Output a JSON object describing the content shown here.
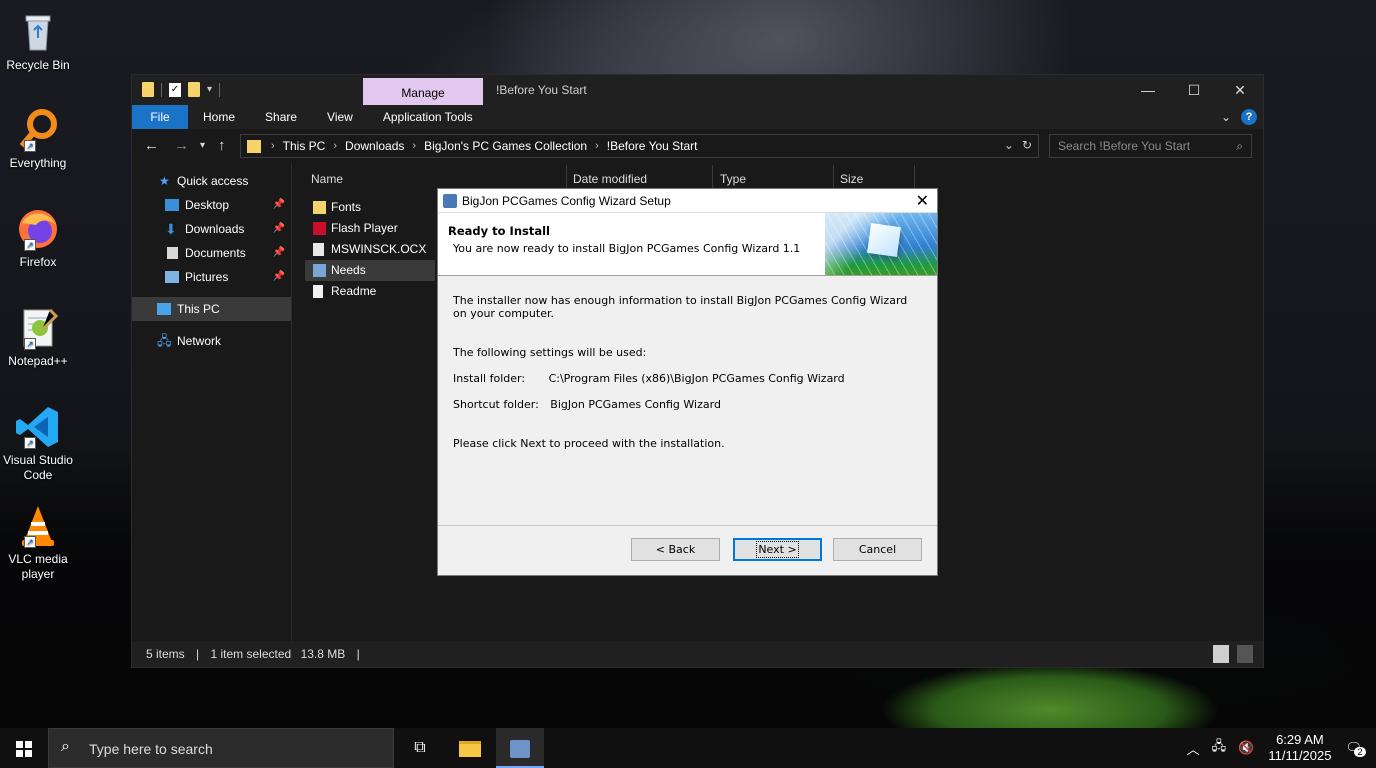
{
  "desktop": {
    "icons": [
      {
        "label": "Recycle Bin",
        "icon": "recycle-bin-icon"
      },
      {
        "label": "Everything",
        "icon": "everything-search-icon"
      },
      {
        "label": "Firefox",
        "icon": "firefox-icon"
      },
      {
        "label": "Notepad++",
        "icon": "notepad-plus-plus-icon"
      },
      {
        "label": "Visual Studio Code",
        "icon": "vscode-icon"
      },
      {
        "label": "VLC media player",
        "icon": "vlc-icon"
      }
    ]
  },
  "explorer": {
    "title": "!Before You Start",
    "manage_tab": "Manage",
    "ribbon_tabs": [
      "File",
      "Home",
      "Share",
      "View",
      "Application Tools"
    ],
    "breadcrumb": [
      "This PC",
      "Downloads",
      "BigJon's PC Games Collection",
      "!Before You Start"
    ],
    "search_placeholder": "Search !Before You Start",
    "nav": {
      "quick_access": "Quick access",
      "items": [
        "Desktop",
        "Downloads",
        "Documents",
        "Pictures"
      ],
      "this_pc": "This PC",
      "network": "Network"
    },
    "columns": [
      "Name",
      "Date modified",
      "Type",
      "Size"
    ],
    "files": [
      {
        "name": "Fonts",
        "icon": "folder-icon"
      },
      {
        "name": "Flash Player",
        "icon": "flash-player-icon"
      },
      {
        "name": "MSWINSCK.OCX",
        "icon": "ocx-file-icon"
      },
      {
        "name": "Needs",
        "icon": "installer-icon"
      },
      {
        "name": "Readme",
        "icon": "text-file-icon"
      }
    ],
    "status": {
      "items": "5 items",
      "selected": "1 item selected",
      "size": "13.8 MB"
    }
  },
  "wizard": {
    "title": "BigJon PCGames Config Wizard Setup",
    "heading": "Ready to Install",
    "subheading": "You are now ready to install BigJon PCGames Config Wizard 1.1",
    "body1": "The installer now has enough information to install BigJon PCGames Config Wizard on your computer.",
    "body2": "The following settings will be used:",
    "install_folder_label": "Install folder:",
    "install_folder_value": "C:\\Program Files (x86)\\BigJon PCGames Config Wizard",
    "shortcut_folder_label": "Shortcut folder:",
    "shortcut_folder_value": "BigJon PCGames Config Wizard",
    "body3": "Please click Next to proceed with the installation.",
    "back": "< Back",
    "next": "Next >",
    "cancel": "Cancel"
  },
  "taskbar": {
    "search_placeholder": "Type here to search",
    "time": "6:29 AM",
    "date": "11/11/2025",
    "notifications": "2"
  }
}
